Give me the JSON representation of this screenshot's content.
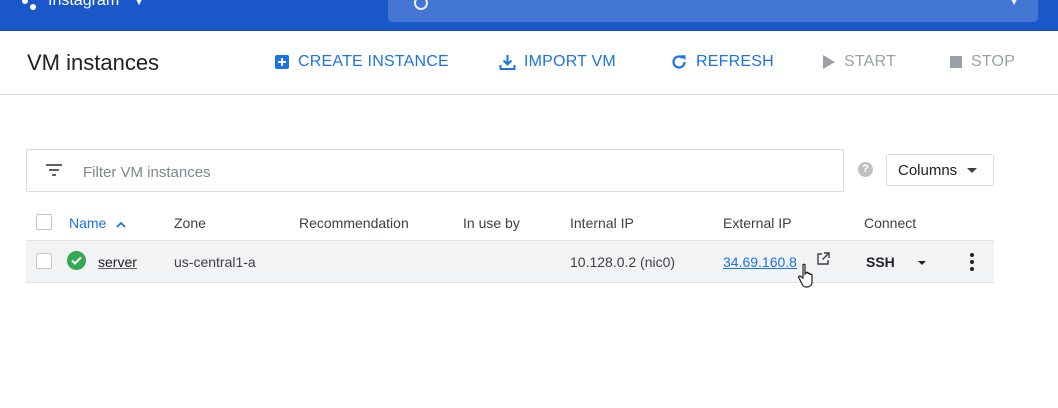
{
  "topbar": {
    "project_name": "Instagram",
    "accent": "#1a57c9"
  },
  "toolbar": {
    "title": "VM instances",
    "buttons": [
      {
        "label": "CREATE INSTANCE",
        "icon": "add-box-icon",
        "enabled": true
      },
      {
        "label": "IMPORT VM",
        "icon": "download-icon",
        "enabled": true
      },
      {
        "label": "REFRESH",
        "icon": "refresh-icon",
        "enabled": true
      },
      {
        "label": "START",
        "icon": "play-icon",
        "enabled": false
      },
      {
        "label": "STOP",
        "icon": "stop-icon",
        "enabled": false
      }
    ]
  },
  "filter": {
    "placeholder": "Filter VM instances",
    "value": ""
  },
  "columns_button": {
    "label": "Columns"
  },
  "table": {
    "headers": [
      "Name",
      "Zone",
      "Recommendation",
      "In use by",
      "Internal IP",
      "External IP",
      "Connect"
    ],
    "sorted_column": "Name",
    "sort_direction": "ascending",
    "rows": [
      {
        "status": "running",
        "name": "server",
        "zone": "us-central1-a",
        "recommendation": "",
        "in_use_by": "",
        "internal_ip": "10.128.0.2 (nic0)",
        "external_ip": "34.69.160.8",
        "connect": "SSH"
      }
    ]
  },
  "colors": {
    "link": "#1a73e8",
    "status_ok": "#34a853",
    "disabled": "#9aa0a6"
  }
}
